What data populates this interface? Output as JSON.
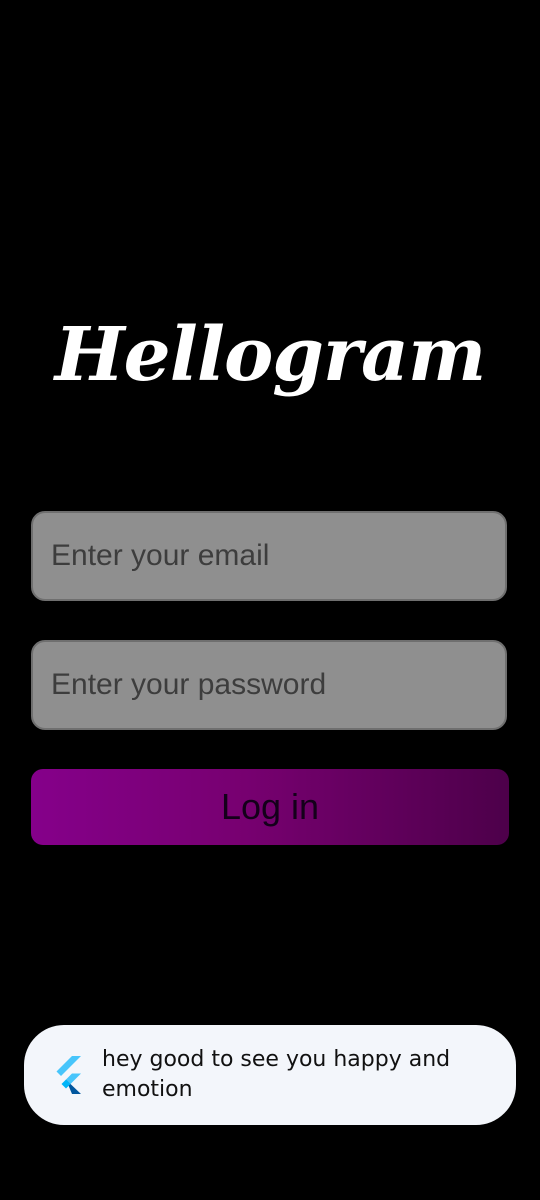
{
  "app": {
    "logo_text": "Hellogram"
  },
  "login_form": {
    "email_placeholder": "Enter your email",
    "password_placeholder": "Enter your password",
    "login_label": "Log in"
  },
  "toast": {
    "icon": "flutter-icon",
    "message": "hey good to see you happy and emotion"
  },
  "colors": {
    "background": "#000000",
    "field_fill": "#8f8f8f",
    "button_gradient_start": "#85008a",
    "button_gradient_end": "#4d004a",
    "toast_background": "#f3f6fb"
  }
}
